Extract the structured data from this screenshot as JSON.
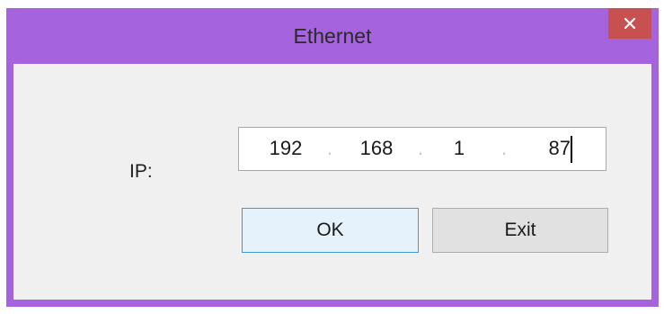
{
  "window": {
    "title": "Ethernet",
    "close_symbol": "×",
    "accent_color": "#a663de",
    "close_color": "#c75050"
  },
  "ip": {
    "label": "IP:",
    "octets": [
      "192",
      "168",
      "1",
      "87"
    ],
    "separator": "."
  },
  "buttons": {
    "ok_label": "OK",
    "exit_label": "Exit"
  }
}
